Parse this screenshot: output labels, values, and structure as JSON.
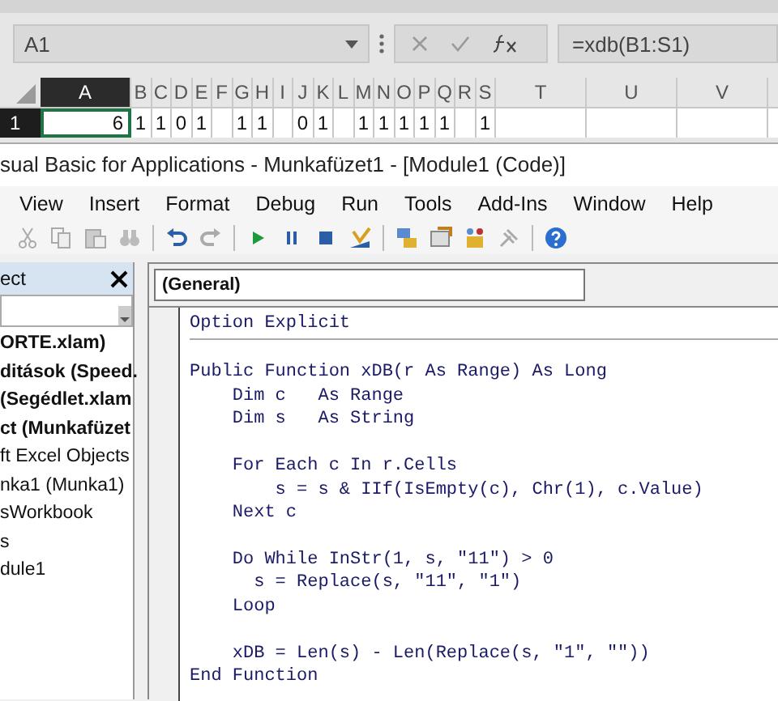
{
  "formula_bar": {
    "name_box": "A1",
    "formula": "=xdb(B1:S1)"
  },
  "sheet": {
    "columns": [
      {
        "label": "A",
        "selected": true,
        "wide": true
      },
      {
        "label": "B",
        "selected": false,
        "wide": false
      },
      {
        "label": "C",
        "selected": false,
        "wide": false
      },
      {
        "label": "D",
        "selected": false,
        "wide": false
      },
      {
        "label": "E",
        "selected": false,
        "wide": false
      },
      {
        "label": "F",
        "selected": false,
        "wide": false
      },
      {
        "label": "G",
        "selected": false,
        "wide": false
      },
      {
        "label": "H",
        "selected": false,
        "wide": false
      },
      {
        "label": "I",
        "selected": false,
        "wide": false
      },
      {
        "label": "J",
        "selected": false,
        "wide": false
      },
      {
        "label": "K",
        "selected": false,
        "wide": false
      },
      {
        "label": "L",
        "selected": false,
        "wide": false
      },
      {
        "label": "M",
        "selected": false,
        "wide": false
      },
      {
        "label": "N",
        "selected": false,
        "wide": false
      },
      {
        "label": "O",
        "selected": false,
        "wide": false
      },
      {
        "label": "P",
        "selected": false,
        "wide": false
      },
      {
        "label": "Q",
        "selected": false,
        "wide": false
      },
      {
        "label": "R",
        "selected": false,
        "wide": false
      },
      {
        "label": "S",
        "selected": false,
        "wide": false
      },
      {
        "label": "T",
        "selected": false,
        "wide": true
      },
      {
        "label": "U",
        "selected": false,
        "wide": true
      },
      {
        "label": "V",
        "selected": false,
        "wide": true
      }
    ],
    "rows": [
      {
        "header": "1",
        "cells": [
          "6",
          "1",
          "1",
          "0",
          "1",
          null,
          "1",
          "1",
          null,
          "0",
          "1",
          null,
          "1",
          "1",
          "1",
          "1",
          "1",
          null,
          "1",
          null,
          null,
          null
        ]
      }
    ]
  },
  "vba": {
    "title": "sual Basic for Applications - Munkafüzet1 - [Module1 (Code)]",
    "menu": [
      "View",
      "Insert",
      "Format",
      "Debug",
      "Run",
      "Tools",
      "Add-Ins",
      "Window",
      "Help"
    ],
    "project": {
      "title": "ect",
      "items": [
        {
          "label": "ORTE.xlam)",
          "bold": true
        },
        {
          "label": "ditások (Speed.",
          "bold": true
        },
        {
          "label": "(Segédlet.xlam",
          "bold": true
        },
        {
          "label": "ct (Munkafüzet",
          "bold": true
        },
        {
          "label": "ft Excel Objects",
          "bold": false
        },
        {
          "label": "nka1 (Munka1)",
          "bold": false
        },
        {
          "label": "sWorkbook",
          "bold": false
        },
        {
          "label": "s",
          "bold": false
        },
        {
          "label": "dule1",
          "bold": false
        }
      ]
    },
    "object_box": "(General)",
    "code_blocks": [
      [
        "Option Explicit"
      ],
      [
        "Public Function xDB(r As Range) As Long",
        "    Dim c   As Range",
        "    Dim s   As String"
      ],
      [
        "    For Each c In r.Cells",
        "        s = s & IIf(IsEmpty(c), Chr(1), c.Value)",
        "    Next c"
      ],
      [
        "    Do While InStr(1, s, \"11\") > 0",
        "      s = Replace(s, \"11\", \"1\")",
        "    Loop"
      ],
      [
        "    xDB = Len(s) - Len(Replace(s, \"1\", \"\"))",
        "End Function"
      ]
    ]
  }
}
